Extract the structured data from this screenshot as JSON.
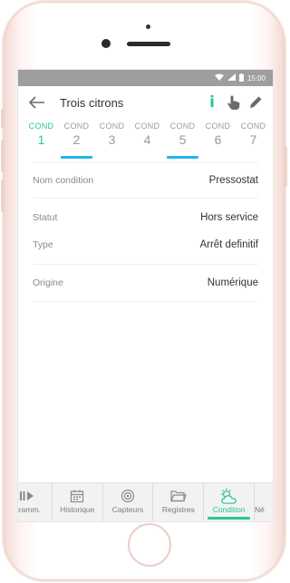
{
  "statusbar": {
    "time": "15:00"
  },
  "toolbar": {
    "title": "Trois citrons",
    "info_symbol": "i"
  },
  "tabs": [
    {
      "label": "COND",
      "num": "1"
    },
    {
      "label": "COND",
      "num": "2"
    },
    {
      "label": "COND",
      "num": "3"
    },
    {
      "label": "COND",
      "num": "4"
    },
    {
      "label": "COND",
      "num": "5"
    },
    {
      "label": "COND",
      "num": "6"
    },
    {
      "label": "COND",
      "num": "7"
    }
  ],
  "details": {
    "nom_condition": {
      "label": "Nom condition",
      "value": "Pressostat"
    },
    "statut": {
      "label": "Statut",
      "value": "Hors service"
    },
    "type": {
      "label": "Type",
      "value": "Arrêt definitif"
    },
    "origine": {
      "label": "Origine",
      "value": "Numérique"
    }
  },
  "bottom_nav": [
    {
      "label": "gramm."
    },
    {
      "label": "Historique"
    },
    {
      "label": "Capteurs"
    },
    {
      "label": "Registres"
    },
    {
      "label": "Condition"
    },
    {
      "label": "Né"
    }
  ],
  "colors": {
    "accent_green": "#27c98c",
    "accent_blue": "#25b5e4",
    "statusbar": "#9e9e9e"
  }
}
